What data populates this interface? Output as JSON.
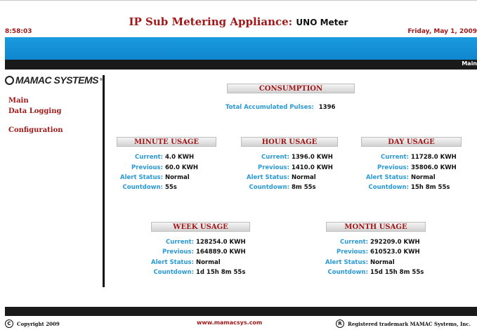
{
  "header": {
    "title": "IP Sub Metering Appliance:",
    "subtitle": "UNO Meter",
    "time": "8:58:03",
    "date": "Friday, May 1, 2009",
    "crumb": "Main"
  },
  "brand": {
    "logo_text": "MAMAC SYSTEMS",
    "tm": "®"
  },
  "nav": {
    "main": "Main",
    "data_logging": "Data Logging",
    "configuration": "Configuration"
  },
  "consumption": {
    "header": "CONSUMPTION",
    "label": "Total Accumulated Pulses:",
    "value": "1396"
  },
  "labels": {
    "current": "Current:",
    "previous": "Previous:",
    "alert": "Alert Status:",
    "countdown": "Countdown:"
  },
  "minute": {
    "header": "MINUTE USAGE",
    "current": "4.0 KWH",
    "previous": "60.0 KWH",
    "alert": "Normal",
    "countdown": "55s"
  },
  "hour": {
    "header": "HOUR USAGE",
    "current": "1396.0 KWH",
    "previous": "1410.0 KWH",
    "alert": "Normal",
    "countdown": "8m 55s"
  },
  "day": {
    "header": "DAY USAGE",
    "current": "11728.0 KWH",
    "previous": "35806.0 KWH",
    "alert": "Normal",
    "countdown": "15h 8m 55s"
  },
  "week": {
    "header": "WEEK USAGE",
    "current": "128254.0 KWH",
    "previous": "164889.0 KWH",
    "alert": "Normal",
    "countdown": "1d 15h 8m 55s"
  },
  "month": {
    "header": "MONTH USAGE",
    "current": "292209.0 KWH",
    "previous": "610523.0 KWH",
    "alert": "Normal",
    "countdown": "15d 15h 8m 55s"
  },
  "footer": {
    "copyright_symbol": "C",
    "copyright": "Copyright 2009",
    "website": "www.mamacsys.com",
    "registered_symbol": "R",
    "trademark": "Registered trademark MAMAC Systems, Inc."
  },
  "colors": {
    "accent": "#a01818",
    "label_blue": "#2a9ad8",
    "band_blue": "#1591d6",
    "band_dark": "#1a1a1a"
  }
}
